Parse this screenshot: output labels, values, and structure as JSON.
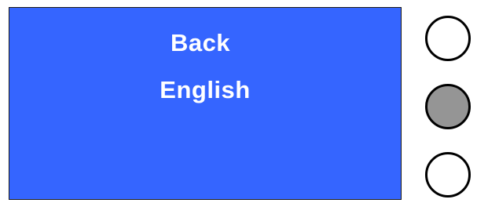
{
  "screen": {
    "background_color": "#3565ff",
    "text_color": "#ffffff",
    "menu_items": [
      {
        "label": "Back"
      },
      {
        "label": "English"
      }
    ]
  },
  "side_buttons": [
    {
      "name": "top",
      "state": "unselected",
      "color": "#ffffff"
    },
    {
      "name": "middle",
      "state": "selected",
      "color": "#959595"
    },
    {
      "name": "bottom",
      "state": "unselected",
      "color": "#ffffff"
    }
  ]
}
